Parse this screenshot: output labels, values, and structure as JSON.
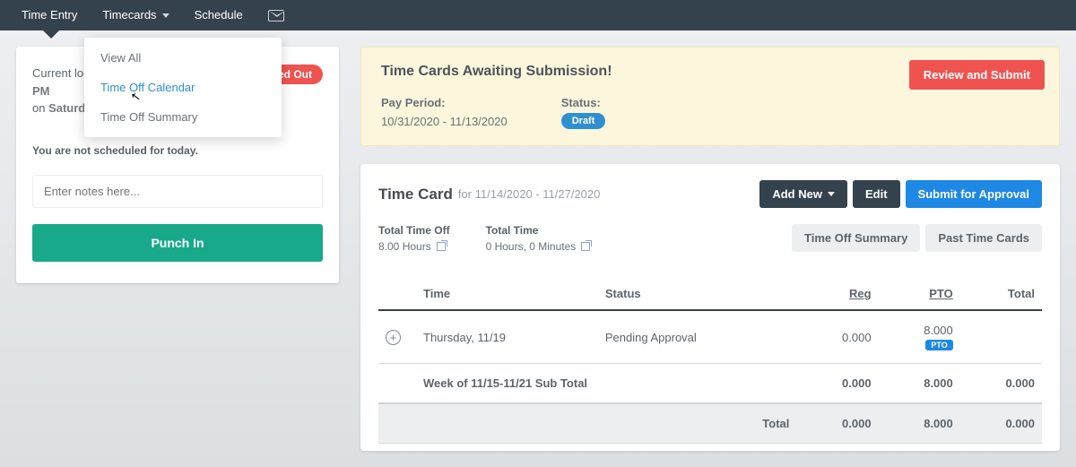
{
  "nav": {
    "time_entry": "Time Entry",
    "timecards": "Timecards",
    "schedule": "Schedule"
  },
  "dropdown": {
    "view_all": "View All",
    "time_off_calendar": "Time Off Calendar",
    "time_off_summary": "Time Off Summary"
  },
  "left": {
    "current_log_prefix": "Current log",
    "pm": "PM",
    "on": "on ",
    "saturday_frag": "Saturda",
    "punched_out": "Punched Out",
    "not_scheduled": "You are not scheduled for today.",
    "notes_placeholder": "Enter notes here...",
    "punch_in": "Punch In"
  },
  "alert": {
    "title": "Time Cards Awaiting Submission!",
    "pay_period_label": "Pay Period:",
    "pay_period_value": "10/31/2020 - 11/13/2020",
    "status_label": "Status:",
    "status_value": "Draft",
    "review_btn": "Review and Submit"
  },
  "timecard": {
    "title": "Time Card",
    "range_prefix": "for ",
    "range": "11/14/2020 - 11/27/2020",
    "add_new": "Add New",
    "edit": "Edit",
    "submit": "Submit for Approval",
    "total_time_off_label": "Total Time Off",
    "total_time_off_value": "8.00 Hours",
    "total_time_label": "Total Time",
    "total_time_value": "0 Hours, 0 Minutes",
    "time_off_summary_btn": "Time Off Summary",
    "past_btn": "Past Time Cards",
    "cols": {
      "time": "Time",
      "status": "Status",
      "reg": "Reg",
      "pto": "PTO",
      "total": "Total"
    },
    "row": {
      "day": "Thursday, 11/19",
      "status": "Pending Approval",
      "reg": "0.000",
      "pto": "8.000",
      "pto_badge": "PTO",
      "total": ""
    },
    "subtotal": {
      "label": "Week of 11/15-11/21 Sub Total",
      "reg": "0.000",
      "pto": "8.000",
      "total": "0.000"
    },
    "grand": {
      "label": "Total",
      "reg": "0.000",
      "pto": "8.000",
      "total": "0.000"
    }
  }
}
